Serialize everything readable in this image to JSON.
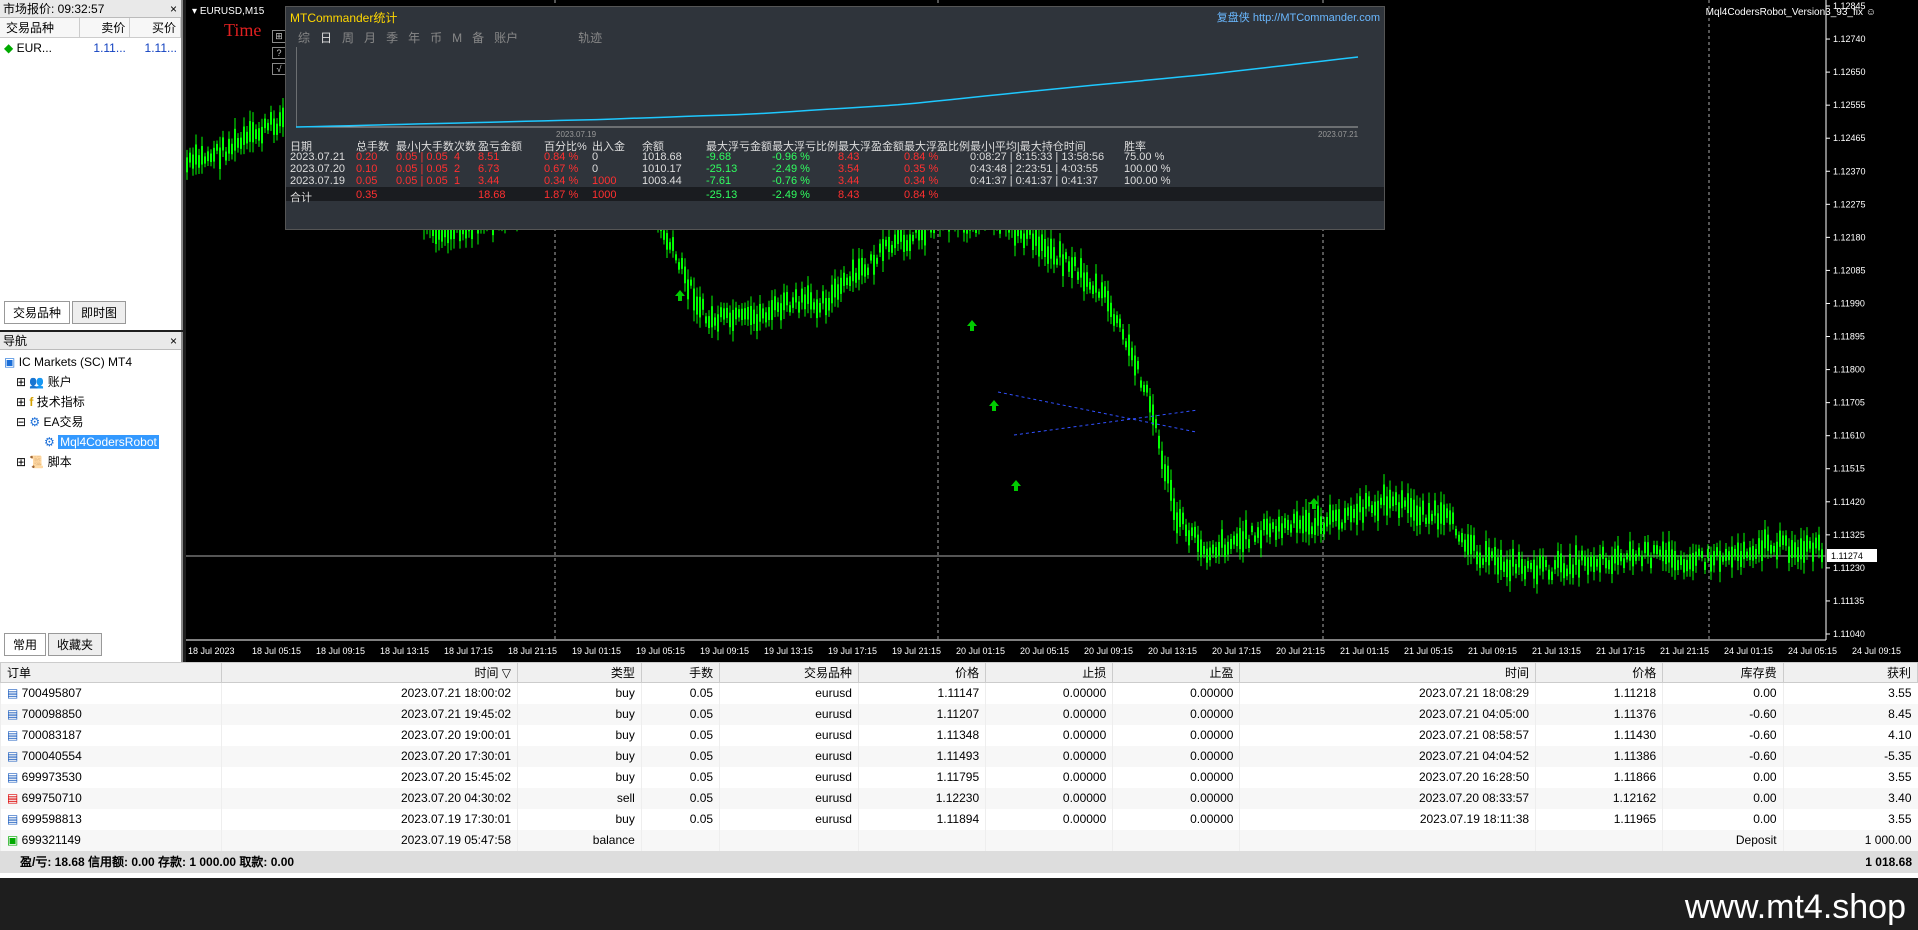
{
  "market_watch": {
    "title": "市场报价: 09:32:57",
    "columns": [
      "交易品种",
      "卖价",
      "买价"
    ],
    "rows": [
      {
        "symbol": "EUR...",
        "bid": "1.11...",
        "ask": "1.11..."
      }
    ],
    "tabs": [
      "交易品种",
      "即时图"
    ]
  },
  "navigator": {
    "title": "导航",
    "items": [
      "IC Markets (SC) MT4",
      "账户",
      "技术指标",
      "EA交易",
      "Mql4CodersRobot",
      "脚本"
    ],
    "tabs": [
      "常用",
      "收藏夹"
    ]
  },
  "chart": {
    "symbol": "EURUSD,M15",
    "ea_label": "Mql4CodersRobot_Version3_93_fix",
    "time_label": "Time",
    "y_ticks": [
      "1.12845",
      "1.12740",
      "1.12650",
      "1.12555",
      "1.12465",
      "1.12370",
      "1.12275",
      "1.12180",
      "1.12085",
      "1.11990",
      "1.11895",
      "1.11800",
      "1.11705",
      "1.11610",
      "1.11515",
      "1.11420",
      "1.11325",
      "1.11230",
      "1.11135",
      "1.11040"
    ],
    "current_price": "1.11274",
    "x_ticks": [
      "18 Jul 2023",
      "18 Jul 05:15",
      "18 Jul 09:15",
      "18 Jul 13:15",
      "18 Jul 17:15",
      "18 Jul 21:15",
      "19 Jul 01:15",
      "19 Jul 05:15",
      "19 Jul 09:15",
      "19 Jul 13:15",
      "19 Jul 17:15",
      "19 Jul 21:15",
      "20 Jul 01:15",
      "20 Jul 05:15",
      "20 Jul 09:15",
      "20 Jul 13:15",
      "20 Jul 17:15",
      "20 Jul 21:15",
      "21 Jul 01:15",
      "21 Jul 05:15",
      "21 Jul 09:15",
      "21 Jul 13:15",
      "21 Jul 17:15",
      "21 Jul 21:15",
      "24 Jul 01:15",
      "24 Jul 05:15",
      "24 Jul 09:15"
    ]
  },
  "stats": {
    "title": "MTCommander统计",
    "link": "复盘侠 http://MTCommander.com",
    "tabs": [
      "综",
      "日",
      "周",
      "月",
      "季",
      "年",
      "币",
      "M",
      "备",
      "账户",
      "轨迹"
    ],
    "date_start": "2023.07.19",
    "date_end": "2023.07.21",
    "headers": [
      "日期",
      "总手数",
      "最小|大手数",
      "次数",
      "盈亏金额",
      "百分比%",
      "出入金",
      "余额",
      "最大浮亏金额",
      "最大浮亏比例",
      "最大浮盈金额",
      "最大浮盈比例",
      "最小|平均|最大持仓时间",
      "胜率"
    ],
    "rows": [
      [
        "2023.07.21",
        "0.20",
        "0.05 | 0.05",
        "4",
        "8.51",
        "0.84 %",
        "0",
        "1018.68",
        "-9.68",
        "-0.96 %",
        "8.43",
        "0.84 %",
        "0:08:27 | 8:15:33 | 13:58:56",
        "75.00 %"
      ],
      [
        "2023.07.20",
        "0.10",
        "0.05 | 0.05",
        "2",
        "6.73",
        "0.67 %",
        "0",
        "1010.17",
        "-25.13",
        "-2.49 %",
        "3.54",
        "0.35 %",
        "0:43:48 | 2:23:51 | 4:03:55",
        "100.00 %"
      ],
      [
        "2023.07.19",
        "0.05",
        "0.05 | 0.05",
        "1",
        "3.44",
        "0.34 %",
        "1000",
        "1003.44",
        "-7.61",
        "-0.76 %",
        "3.44",
        "0.34 %",
        "0:41:37 | 0:41:37 | 0:41:37",
        "100.00 %"
      ]
    ],
    "total": [
      "合计",
      "0.35",
      "",
      "",
      "18.68",
      "1.87 %",
      "1000",
      "",
      "-25.13",
      "-2.49 %",
      "8.43",
      "0.84 %",
      "",
      ""
    ],
    "equity_curve": [
      1000,
      1001,
      1002,
      1003.44,
      1006,
      1010.17,
      1014,
      1018.68
    ]
  },
  "terminal": {
    "columns": [
      "订单",
      "时间",
      "类型",
      "手数",
      "交易品种",
      "价格",
      "止损",
      "止盈",
      "时间",
      "价格",
      "库存费",
      "获利"
    ],
    "rows": [
      [
        "700495807",
        "2023.07.21 18:00:02",
        "buy",
        "0.05",
        "eurusd",
        "1.11147",
        "0.00000",
        "0.00000",
        "2023.07.21 18:08:29",
        "1.11218",
        "0.00",
        "3.55"
      ],
      [
        "700098850",
        "2023.07.21 19:45:02",
        "buy",
        "0.05",
        "eurusd",
        "1.11207",
        "0.00000",
        "0.00000",
        "2023.07.21 04:05:00",
        "1.11376",
        "-0.60",
        "8.45"
      ],
      [
        "700083187",
        "2023.07.20 19:00:01",
        "buy",
        "0.05",
        "eurusd",
        "1.11348",
        "0.00000",
        "0.00000",
        "2023.07.21 08:58:57",
        "1.11430",
        "-0.60",
        "4.10"
      ],
      [
        "700040554",
        "2023.07.20 17:30:01",
        "buy",
        "0.05",
        "eurusd",
        "1.11493",
        "0.00000",
        "0.00000",
        "2023.07.21 04:04:52",
        "1.11386",
        "-0.60",
        "-5.35"
      ],
      [
        "699973530",
        "2023.07.20 15:45:02",
        "buy",
        "0.05",
        "eurusd",
        "1.11795",
        "0.00000",
        "0.00000",
        "2023.07.20 16:28:50",
        "1.11866",
        "0.00",
        "3.55"
      ],
      [
        "699750710",
        "2023.07.20 04:30:02",
        "sell",
        "0.05",
        "eurusd",
        "1.12230",
        "0.00000",
        "0.00000",
        "2023.07.20 08:33:57",
        "1.12162",
        "0.00",
        "3.40"
      ],
      [
        "699598813",
        "2023.07.19 17:30:01",
        "buy",
        "0.05",
        "eurusd",
        "1.11894",
        "0.00000",
        "0.00000",
        "2023.07.19 18:11:38",
        "1.11965",
        "0.00",
        "3.55"
      ],
      [
        "699321149",
        "2023.07.19 05:47:58",
        "balance",
        "",
        "",
        "",
        "",
        "",
        "",
        "",
        "Deposit",
        "1 000.00"
      ]
    ],
    "summary": "盈/亏: 18.68  信用额: 0.00  存款: 1 000.00  取款: 0.00",
    "summary_total": "1 018.68"
  },
  "watermark": "www.mt4.shop",
  "colors": {
    "candle": "#00ff00",
    "curve": "#1ec8ff",
    "negative": "#ff3030",
    "positive": "#30ff60"
  }
}
